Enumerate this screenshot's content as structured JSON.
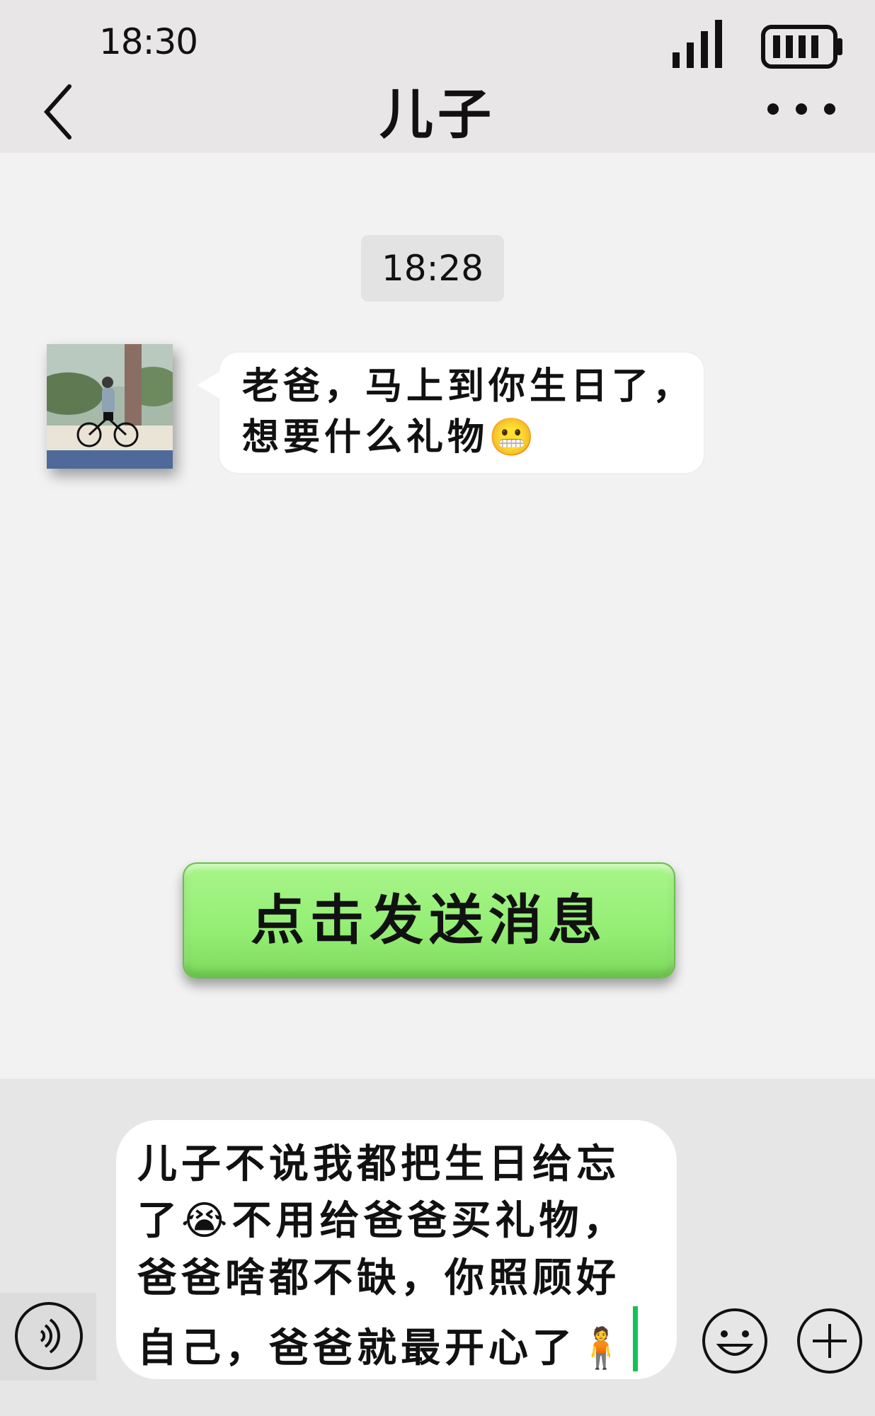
{
  "status_bar": {
    "time": "18:30"
  },
  "header": {
    "title": "儿子"
  },
  "chat": {
    "timestamp": "18:28",
    "received_message": "老爸，马上到你生日了，想要什么礼物",
    "received_emoji": "😬"
  },
  "send_button": {
    "label": "点击发送消息"
  },
  "input": {
    "text_part1": "儿子不说我都把生日给忘了",
    "emoji_1": "😭",
    "text_part2": "不用给爸爸买礼物，爸爸啥都不缺，你照顾好自己，爸爸就最开心了",
    "emoji_2": "🧍"
  },
  "colors": {
    "accent_green": "#95ef76",
    "caret_green": "#13c257",
    "header_bg": "#e8e6e6",
    "chat_bg": "#f2f2f2"
  },
  "icons": [
    "back-icon",
    "signal-icon",
    "battery-icon",
    "more-icon",
    "voice-icon",
    "emoji-icon",
    "plus-icon"
  ]
}
